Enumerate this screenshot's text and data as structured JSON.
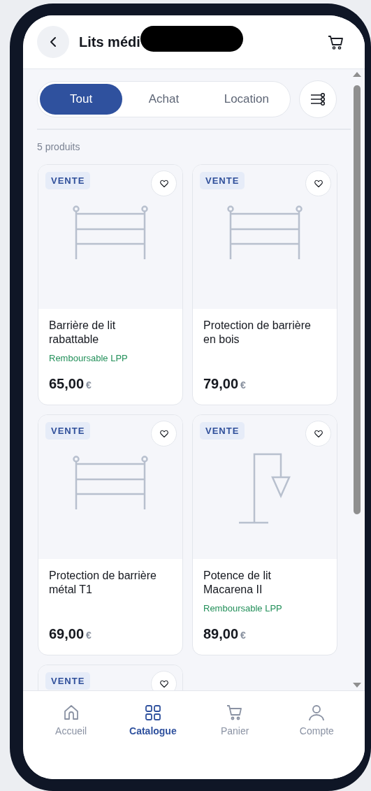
{
  "header": {
    "title": "Lits médi"
  },
  "tabs": [
    {
      "label": "Tout",
      "selected": true
    },
    {
      "label": "Achat",
      "selected": false
    },
    {
      "label": "Location",
      "selected": false
    }
  ],
  "count": "5 produits",
  "products": [
    {
      "badge": "VENTE",
      "kind": "rail",
      "title": "Barrière de lit\nrabattable",
      "reimbursement": "Remboursable LPP",
      "price": "65,00",
      "currency": "€"
    },
    {
      "badge": "VENTE",
      "kind": "rail",
      "title": "Protection de barrière\nen bois",
      "price": "79,00",
      "currency": "€"
    },
    {
      "badge": "VENTE",
      "kind": "rail",
      "title": "Protection de barrière\nmétal T1",
      "price": "69,00",
      "currency": "€"
    },
    {
      "badge": "VENTE",
      "kind": "pole",
      "title": "Potence de lit\nMacarena II",
      "reimbursement": "Remboursable LPP",
      "price": "89,00",
      "currency": "€"
    },
    {
      "badge": "VENTE"
    }
  ],
  "nav": [
    {
      "label": "Accueil",
      "kind": "home",
      "selected": false
    },
    {
      "label": "Catalogue",
      "kind": "grid",
      "selected": true
    },
    {
      "label": "Panier",
      "kind": "cart",
      "selected": false
    },
    {
      "label": "Compte",
      "kind": "user",
      "selected": false
    }
  ]
}
